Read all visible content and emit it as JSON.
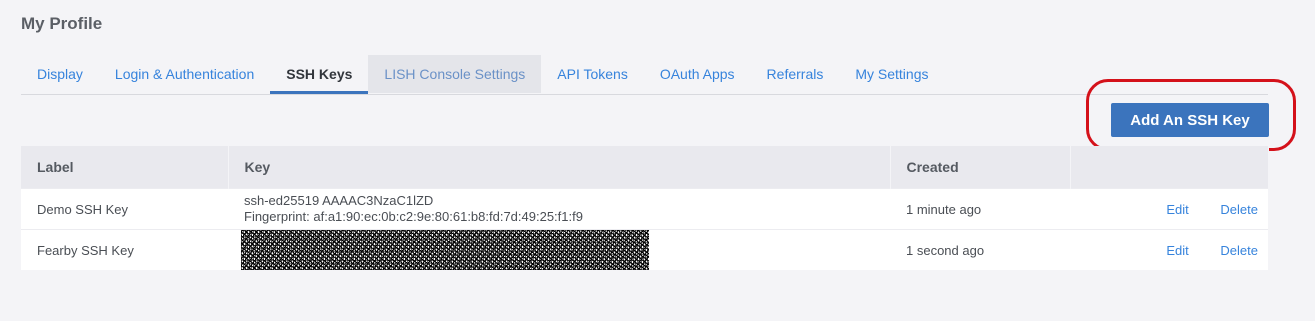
{
  "page": {
    "title": "My Profile"
  },
  "tabs": [
    {
      "label": "Display"
    },
    {
      "label": "Login & Authentication"
    },
    {
      "label": "SSH Keys"
    },
    {
      "label": "LISH Console Settings"
    },
    {
      "label": "API Tokens"
    },
    {
      "label": "OAuth Apps"
    },
    {
      "label": "Referrals"
    },
    {
      "label": "My Settings"
    }
  ],
  "active_tab": "SSH Keys",
  "hovered_tab": "LISH Console Settings",
  "toolbar": {
    "add_label": "Add An SSH Key"
  },
  "table": {
    "headers": {
      "label": "Label",
      "key": "Key",
      "created": "Created"
    },
    "rows": [
      {
        "label": "Demo SSH Key",
        "key": "ssh-ed25519 AAAAC3NzaC1lZD",
        "fingerprint": "Fingerprint: af:a1:90:ec:0b:c2:9e:80:61:b8:fd:7d:49:25:f1:f9",
        "created": "1 minute ago",
        "edit": "Edit",
        "delete": "Delete"
      },
      {
        "label": "Fearby SSH Key",
        "key_redacted": true,
        "created": "1 second ago",
        "edit": "Edit",
        "delete": "Delete"
      }
    ]
  },
  "colors": {
    "accent": "#3b74bd",
    "link": "#3683dc",
    "highlight": "#d4111a"
  }
}
